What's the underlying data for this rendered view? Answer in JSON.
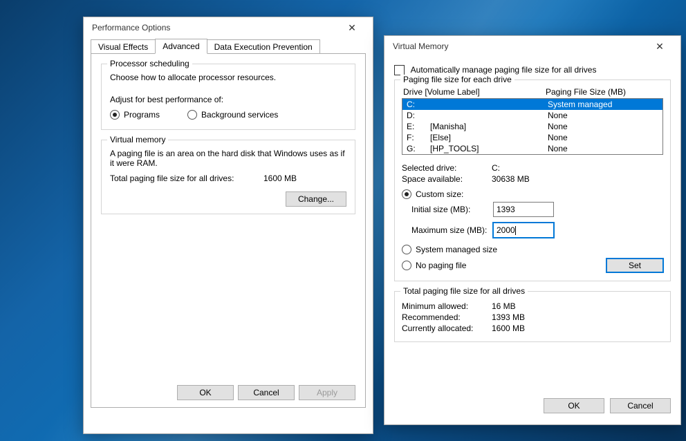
{
  "perf": {
    "title": "Performance Options",
    "tabs": {
      "visual": "Visual Effects",
      "advanced": "Advanced",
      "dep": "Data Execution Prevention"
    },
    "proc": {
      "legend": "Processor scheduling",
      "desc": "Choose how to allocate processor resources.",
      "adjust": "Adjust for best performance of:",
      "programs": "Programs",
      "background": "Background services"
    },
    "vm": {
      "legend": "Virtual memory",
      "desc": "A paging file is an area on the hard disk that Windows uses as if it were RAM.",
      "total_label": "Total paging file size for all drives:",
      "total_value": "1600 MB",
      "change": "Change..."
    },
    "buttons": {
      "ok": "OK",
      "cancel": "Cancel",
      "apply": "Apply"
    }
  },
  "vmem": {
    "title": "Virtual Memory",
    "auto": "Automatically manage paging file size for all drives",
    "group1_legend": "Paging file size for each drive",
    "header_drive": "Drive  [Volume Label]",
    "header_size": "Paging File Size (MB)",
    "drives": [
      {
        "d": "C:",
        "l": "",
        "s": "System managed",
        "sel": true
      },
      {
        "d": "D:",
        "l": "",
        "s": "None",
        "sel": false
      },
      {
        "d": "E:",
        "l": "[Manisha]",
        "s": "None",
        "sel": false
      },
      {
        "d": "F:",
        "l": "[Else]",
        "s": "None",
        "sel": false
      },
      {
        "d": "G:",
        "l": "[HP_TOOLS]",
        "s": "None",
        "sel": false
      }
    ],
    "selected_drive_label": "Selected drive:",
    "selected_drive_value": "C:",
    "space_label": "Space available:",
    "space_value": "30638 MB",
    "custom": "Custom size:",
    "initial_label": "Initial size (MB):",
    "initial_value": "1393",
    "max_label": "Maximum size (MB):",
    "max_value": "2000",
    "sys_managed": "System managed size",
    "no_paging": "No paging file",
    "set": "Set",
    "group2_legend": "Total paging file size for all drives",
    "min_label": "Minimum allowed:",
    "min_value": "16 MB",
    "rec_label": "Recommended:",
    "rec_value": "1393 MB",
    "cur_label": "Currently allocated:",
    "cur_value": "1600 MB",
    "ok": "OK",
    "cancel": "Cancel"
  }
}
